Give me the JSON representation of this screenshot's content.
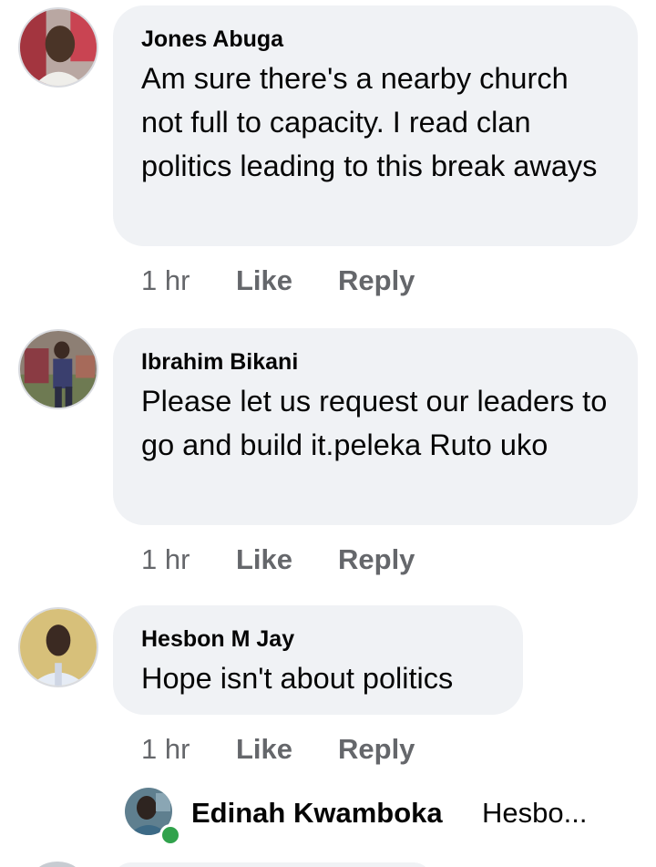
{
  "comments": [
    {
      "author": "Jones Abuga",
      "text": "Am sure there's a nearby church not full to capacity. I read clan politics leading to  this break aways",
      "time": "1 hr",
      "like_label": "Like",
      "reply_label": "Reply"
    },
    {
      "author": "Ibrahim Bikani",
      "text": "Please let us request our leaders to go and build it.peleka Ruto uko",
      "time": "1 hr",
      "like_label": "Like",
      "reply_label": "Reply"
    },
    {
      "author": "Hesbon M Jay",
      "text": "Hope isn't about politics",
      "time": "1 hr",
      "like_label": "Like",
      "reply_label": "Reply"
    }
  ],
  "reply_preview": {
    "author": "Edinah Kwamboka",
    "snippet": "Hesbo..."
  },
  "colors": {
    "bubble": "#f0f2f5",
    "meta_text": "#65676b",
    "online": "#31a24c"
  }
}
